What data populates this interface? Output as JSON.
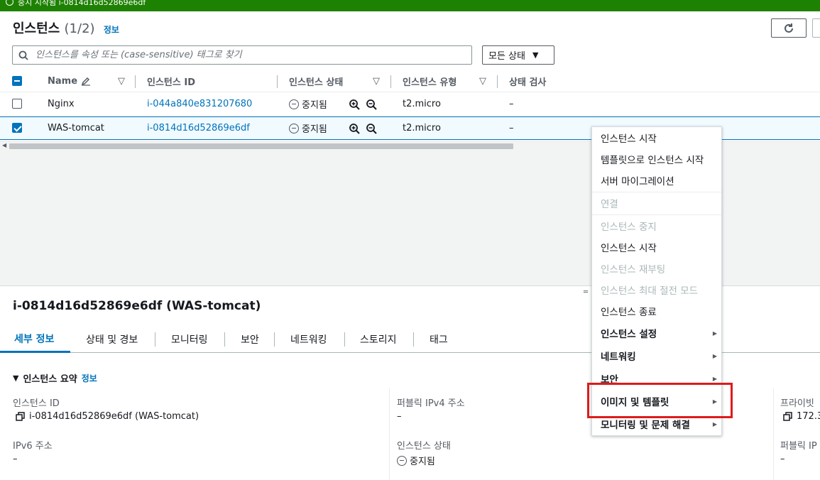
{
  "banner": {
    "text": "중지 시작됨 i-0814d16d52869e6df"
  },
  "header": {
    "title": "인스턴스",
    "count": "(1/2)",
    "info": "정보"
  },
  "search": {
    "placeholder": "인스턴스를 속성 또는 (case-sensitive) 태그로 찾기"
  },
  "state_filter": {
    "label": "모든 상태"
  },
  "columns": {
    "name": "Name",
    "id": "인스턴스 ID",
    "state": "인스턴스 상태",
    "type": "인스턴스 유형",
    "check": "상태 검사"
  },
  "rows": [
    {
      "name": "Nginx",
      "id": "i-044a840e831207680",
      "state": "중지됨",
      "type": "t2.micro",
      "check": "–",
      "selected": false
    },
    {
      "name": "WAS-tomcat",
      "id": "i-0814d16d52869e6df",
      "state": "중지됨",
      "type": "t2.micro",
      "check": "–",
      "selected": true
    }
  ],
  "detail": {
    "title": "i-0814d16d52869e6df (WAS-tomcat)",
    "tabs": [
      "세부 정보",
      "상태 및 경보",
      "모니터링",
      "보안",
      "네트워킹",
      "스토리지",
      "태그"
    ],
    "summary_title": "인스턴스 요약",
    "summary_info": "정보",
    "fields": {
      "instance_id_label": "인스턴스 ID",
      "instance_id_value": "i-0814d16d52869e6df (WAS-tomcat)",
      "public_ipv4_label": "퍼블릭 IPv4 주소",
      "public_ipv4_value": "–",
      "private_label": "프라이빗",
      "private_value": "172.3",
      "ipv6_label": "IPv6 주소",
      "ipv6_value": "–",
      "state_label": "인스턴스 상태",
      "state_value": "중지됨",
      "public_ip_label": "퍼블릭 IP",
      "public_ip_value": "–"
    }
  },
  "context_menu": {
    "items": [
      {
        "label": "인스턴스 시작",
        "disabled": false
      },
      {
        "label": "템플릿으로 인스턴스 시작",
        "disabled": false
      },
      {
        "label": "서버 마이그레이션",
        "disabled": false
      },
      {
        "label": "연결",
        "disabled": true
      },
      {
        "label": "인스턴스 중지",
        "disabled": true
      },
      {
        "label": "인스턴스 시작",
        "disabled": false
      },
      {
        "label": "인스턴스 재부팅",
        "disabled": true
      },
      {
        "label": "인스턴스 최대 절전 모드",
        "disabled": true
      },
      {
        "label": "인스턴스 종료",
        "disabled": false
      },
      {
        "label": "인스턴스 설정",
        "submenu": true
      },
      {
        "label": "네트워킹",
        "submenu": true
      },
      {
        "label": "보안",
        "submenu": true
      },
      {
        "label": "이미지 및 템플릿",
        "submenu": true,
        "highlighted": true
      },
      {
        "label": "모니터링 및 문제 해결",
        "submenu": true
      }
    ]
  },
  "colors": {
    "accent": "#0073bb",
    "banner": "#1d8102",
    "highlight": "#df1b1b"
  }
}
